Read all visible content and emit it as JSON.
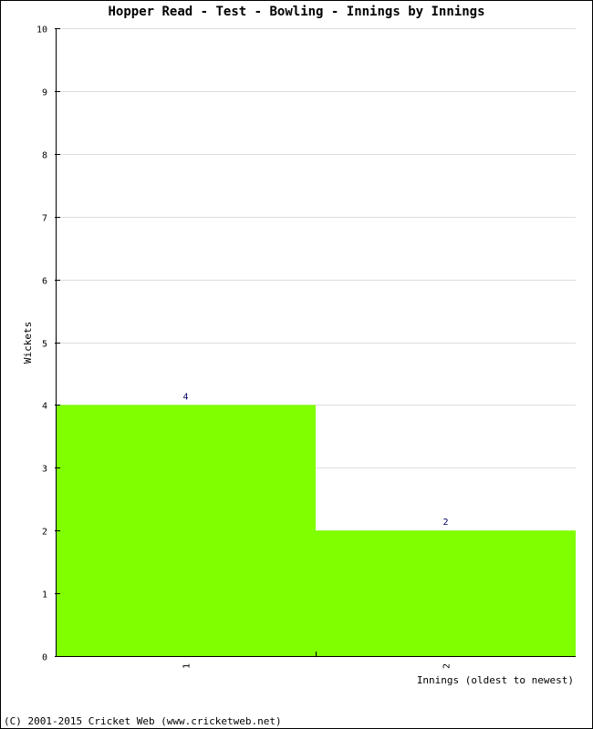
{
  "chart_data": {
    "type": "bar",
    "title": "Hopper Read - Test - Bowling - Innings by Innings",
    "xlabel": "Innings (oldest to newest)",
    "ylabel": "Wickets",
    "categories": [
      "1",
      "2"
    ],
    "values": [
      4,
      2
    ],
    "data_labels": [
      "4",
      "2"
    ],
    "ylim": [
      0,
      10
    ],
    "yticks": [
      0,
      1,
      2,
      3,
      4,
      5,
      6,
      7,
      8,
      9,
      10
    ],
    "grid": true,
    "legend": "none",
    "colors": {
      "bar": "#80ff00",
      "grid": "#dddddd",
      "axis": "#000000",
      "label": "#000066"
    }
  },
  "footer": {
    "copyright": "(C) 2001-2015 Cricket Web (www.cricketweb.net)"
  }
}
